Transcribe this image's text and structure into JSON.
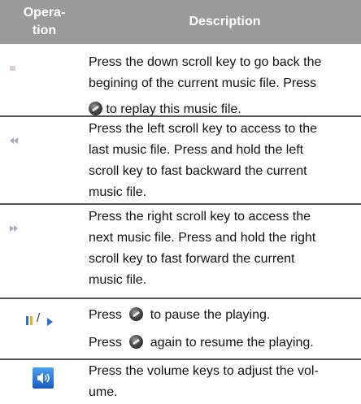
{
  "header": {
    "operation_line1": "Opera-",
    "operation_line2": "tion",
    "description": "Description"
  },
  "rows": [
    {
      "icon": "stop-icon",
      "lines": [
        "Press the down scroll key to go back the",
        "begining of the current music file. Press",
        "to replay this music file."
      ]
    },
    {
      "icon": "previous-icon",
      "lines": [
        "Press the left scroll key to access to the",
        "last music file. Press and hold the left",
        "scroll key to fast backward the current",
        "music file."
      ]
    },
    {
      "icon": "next-icon",
      "lines": [
        "Press the right scroll key to access the",
        "next music file. Press and hold the right",
        "scroll key to fast forward the current",
        "music file."
      ]
    },
    {
      "icon": "pause-play-icon",
      "icon_separator": "/",
      "line1_pre": "Press",
      "line1_post": "to pause the playing.",
      "line2_pre": "Press",
      "line2_post": "again to resume the playing."
    },
    {
      "icon": "volume-icon",
      "lines": [
        "Press the volume keys to adjust the vol-",
        "ume."
      ]
    }
  ],
  "colors": {
    "header_bg": "#9a9a9a",
    "divider": "#555555",
    "icon_blue": "#2d6fd0",
    "icon_grey": "#b0b0b0"
  }
}
